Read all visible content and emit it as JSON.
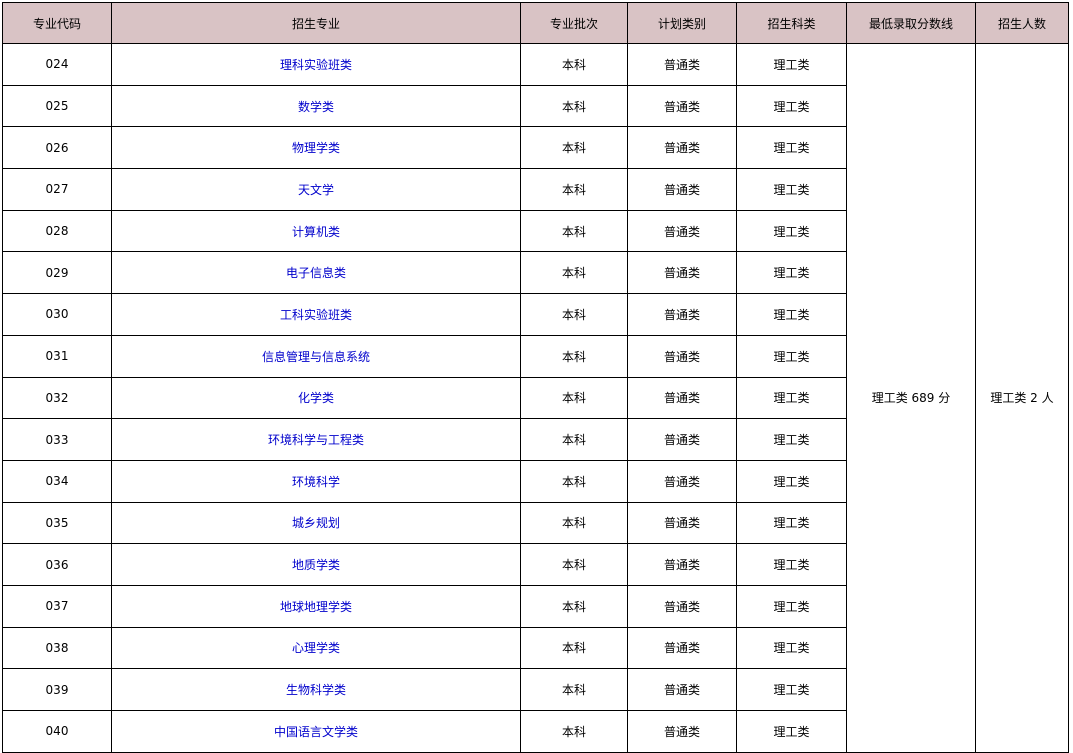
{
  "table": {
    "headers": [
      "专业代码",
      "招生专业",
      "专业批次",
      "计划类别",
      "招生科类",
      "最低录取分数线",
      "招生人数"
    ],
    "rows": [
      {
        "code": "024",
        "major": "理科实验班类",
        "batch": "本科",
        "plan": "普通类",
        "category": "理工类"
      },
      {
        "code": "025",
        "major": "数学类",
        "batch": "本科",
        "plan": "普通类",
        "category": "理工类"
      },
      {
        "code": "026",
        "major": "物理学类",
        "batch": "本科",
        "plan": "普通类",
        "category": "理工类"
      },
      {
        "code": "027",
        "major": "天文学",
        "batch": "本科",
        "plan": "普通类",
        "category": "理工类"
      },
      {
        "code": "028",
        "major": "计算机类",
        "batch": "本科",
        "plan": "普通类",
        "category": "理工类"
      },
      {
        "code": "029",
        "major": "电子信息类",
        "batch": "本科",
        "plan": "普通类",
        "category": "理工类"
      },
      {
        "code": "030",
        "major": "工科实验班类",
        "batch": "本科",
        "plan": "普通类",
        "category": "理工类"
      },
      {
        "code": "031",
        "major": "信息管理与信息系统",
        "batch": "本科",
        "plan": "普通类",
        "category": "理工类"
      },
      {
        "code": "032",
        "major": "化学类",
        "batch": "本科",
        "plan": "普通类",
        "category": "理工类"
      },
      {
        "code": "033",
        "major": "环境科学与工程类",
        "batch": "本科",
        "plan": "普通类",
        "category": "理工类"
      },
      {
        "code": "034",
        "major": "环境科学",
        "batch": "本科",
        "plan": "普通类",
        "category": "理工类"
      },
      {
        "code": "035",
        "major": "城乡规划",
        "batch": "本科",
        "plan": "普通类",
        "category": "理工类"
      },
      {
        "code": "036",
        "major": "地质学类",
        "batch": "本科",
        "plan": "普通类",
        "category": "理工类"
      },
      {
        "code": "037",
        "major": "地球地理学类",
        "batch": "本科",
        "plan": "普通类",
        "category": "理工类"
      },
      {
        "code": "038",
        "major": "心理学类",
        "batch": "本科",
        "plan": "普通类",
        "category": "理工类"
      },
      {
        "code": "039",
        "major": "生物科学类",
        "batch": "本科",
        "plan": "普通类",
        "category": "理工类"
      },
      {
        "code": "040",
        "major": "中国语言文学类",
        "batch": "本科",
        "plan": "普通类",
        "category": "理工类"
      }
    ],
    "min_score": "理工类 689 分",
    "enrollment": "理工类 2 人"
  },
  "colors": {
    "header_bg": "#d9c3c5",
    "link": "#0000cc",
    "border": "#000000"
  }
}
